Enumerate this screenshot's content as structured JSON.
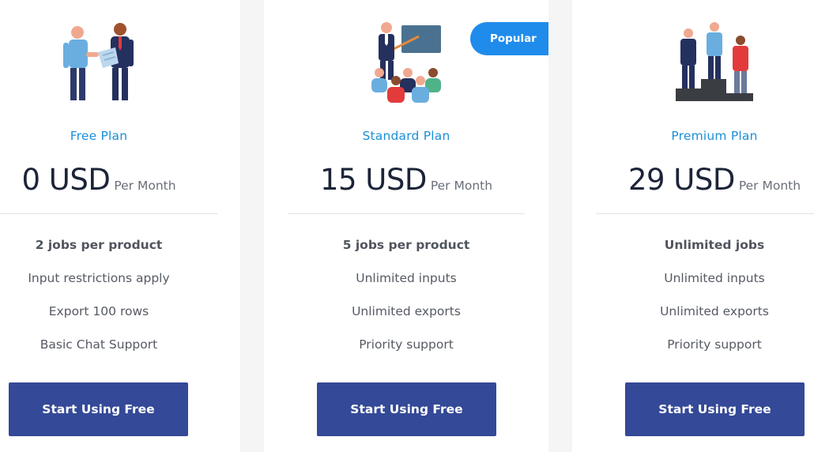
{
  "badge": {
    "label": "Popular",
    "color": "#1f8ceb"
  },
  "colors": {
    "accent": "#1a8fd6",
    "button": "#344997",
    "price": "#1c2438"
  },
  "plans": [
    {
      "illustration": "handshake-people-icon",
      "name": "Free Plan",
      "price": "0 USD",
      "period": "Per Month",
      "features": [
        "2 jobs per product",
        "Input restrictions apply",
        "Export 100 rows",
        "Basic Chat Support"
      ],
      "cta": "Start Using Free"
    },
    {
      "illustration": "presentation-audience-icon",
      "name": "Standard Plan",
      "price": "15 USD",
      "period": "Per Month",
      "features": [
        "5 jobs per product",
        "Unlimited inputs",
        "Unlimited exports",
        "Priority support"
      ],
      "cta": "Start Using Free"
    },
    {
      "illustration": "podium-winners-icon",
      "name": "Premium Plan",
      "price": "29 USD",
      "period": "Per Month",
      "features": [
        "Unlimited jobs",
        "Unlimited inputs",
        "Unlimited exports",
        "Priority support"
      ],
      "cta": "Start Using Free"
    }
  ]
}
